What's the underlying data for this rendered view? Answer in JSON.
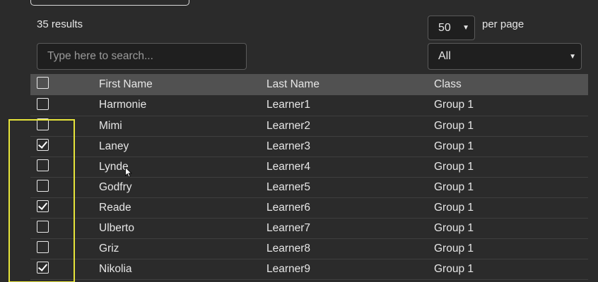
{
  "results": {
    "count_label": "35 results"
  },
  "pagination": {
    "per_page_value": "50",
    "per_page_label": "per page"
  },
  "search": {
    "placeholder": "Type here to search..."
  },
  "class_filter": {
    "selected": "All"
  },
  "table": {
    "headers": {
      "first_name": "First Name",
      "last_name": "Last Name",
      "class": "Class"
    },
    "rows": [
      {
        "first": "Harmonie",
        "last": "Learner1",
        "class": "Group 1",
        "checked": false
      },
      {
        "first": "Mimi",
        "last": "Learner2",
        "class": "Group 1",
        "checked": false
      },
      {
        "first": "Laney",
        "last": "Learner3",
        "class": "Group 1",
        "checked": true
      },
      {
        "first": "Lynde",
        "last": "Learner4",
        "class": "Group 1",
        "checked": false
      },
      {
        "first": "Godfry",
        "last": "Learner5",
        "class": "Group 1",
        "checked": false
      },
      {
        "first": "Reade",
        "last": "Learner6",
        "class": "Group 1",
        "checked": true
      },
      {
        "first": "Ulberto",
        "last": "Learner7",
        "class": "Group 1",
        "checked": false
      },
      {
        "first": "Griz",
        "last": "Learner8",
        "class": "Group 1",
        "checked": false
      },
      {
        "first": "Nikolia",
        "last": "Learner9",
        "class": "Group 1",
        "checked": true
      }
    ]
  },
  "colors": {
    "background": "#2b2b2b",
    "header_row": "#515151",
    "highlight": "#e6e43a"
  }
}
